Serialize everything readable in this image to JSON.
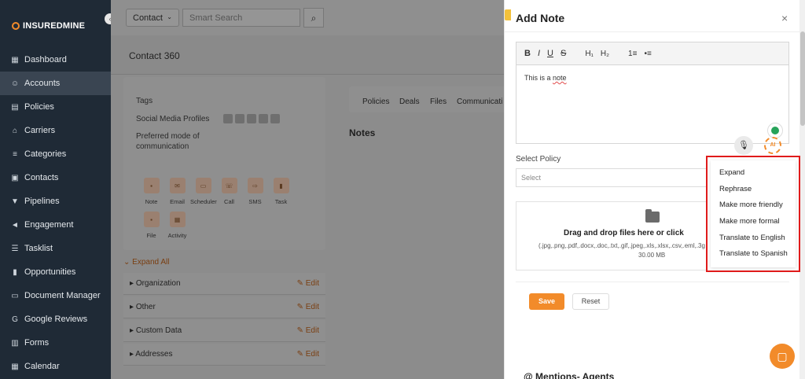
{
  "brand": {
    "logo_text": "INSUREDMINE"
  },
  "sidebar": {
    "items": [
      {
        "label": "Dashboard",
        "icon": "dashboard-icon",
        "active": false
      },
      {
        "label": "Accounts",
        "icon": "accounts-icon",
        "active": true
      },
      {
        "label": "Policies",
        "icon": "policies-icon",
        "active": false
      },
      {
        "label": "Carriers",
        "icon": "carriers-icon",
        "active": false
      },
      {
        "label": "Categories",
        "icon": "categories-icon",
        "active": false
      },
      {
        "label": "Contacts",
        "icon": "contacts-icon",
        "active": false
      },
      {
        "label": "Pipelines",
        "icon": "pipelines-icon",
        "active": false
      },
      {
        "label": "Engagement",
        "icon": "engagement-icon",
        "active": false
      },
      {
        "label": "Tasklist",
        "icon": "tasklist-icon",
        "active": false
      },
      {
        "label": "Opportunities",
        "icon": "opportunities-icon",
        "active": false
      },
      {
        "label": "Document Manager",
        "icon": "folder-icon",
        "active": false
      },
      {
        "label": "Google Reviews",
        "icon": "google-icon",
        "active": false
      },
      {
        "label": "Forms",
        "icon": "forms-icon",
        "active": false
      },
      {
        "label": "Calendar",
        "icon": "calendar-icon",
        "active": false
      }
    ]
  },
  "topbar": {
    "contact_select": "Contact",
    "search_placeholder": "Smart Search"
  },
  "page": {
    "title": "Contact 360",
    "info": {
      "tags_label": "Tags",
      "social_label": "Social Media Profiles",
      "preferred_label_1": "Preferred mode of",
      "preferred_label_2": "communication"
    },
    "actions": [
      "Note",
      "Email",
      "Scheduler",
      "Call",
      "SMS",
      "Task",
      "File",
      "Activity"
    ],
    "expand_all": "Expand All",
    "accordions": [
      {
        "label": "Organization",
        "edit": "Edit"
      },
      {
        "label": "Other",
        "edit": "Edit"
      },
      {
        "label": "Custom Data",
        "edit": "Edit"
      },
      {
        "label": "Addresses",
        "edit": "Edit"
      }
    ],
    "tabs": [
      "Policies",
      "Deals",
      "Files",
      "Communicati"
    ],
    "notes_title": "Notes"
  },
  "modal": {
    "title": "Add Note",
    "close": "×",
    "toolbar": {
      "bold": "B",
      "italic": "I",
      "underline": "U",
      "strike": "S",
      "h1": "H₁",
      "h2": "H₂",
      "ol": "1≡",
      "ul": "•≡"
    },
    "editor_text_prefix": "This is a ",
    "editor_text_word": "note",
    "ai_badge": "AI",
    "select_policy_label": "Select Policy",
    "select_placeholder": "Select",
    "dropzone": {
      "main": "Drag and drop files here or click",
      "types": "(.jpg,.png,.pdf,.docx,.doc,.txt,.gif,.jpeg,.xls,.xlsx,.csv,.eml,.3g",
      "size": "30.00 MB"
    },
    "save_label": "Save",
    "reset_label": "Reset",
    "mentions_label": "@ Mentions- Agents"
  },
  "ai_menu": {
    "items": [
      "Expand",
      "Rephrase",
      "Make more friendly",
      "Make more formal",
      "Translate to English",
      "Translate to Spanish"
    ]
  },
  "colors": {
    "accent": "#f28b2a",
    "sidebar_bg": "#1f2a36",
    "highlight": "#e01b1b"
  }
}
